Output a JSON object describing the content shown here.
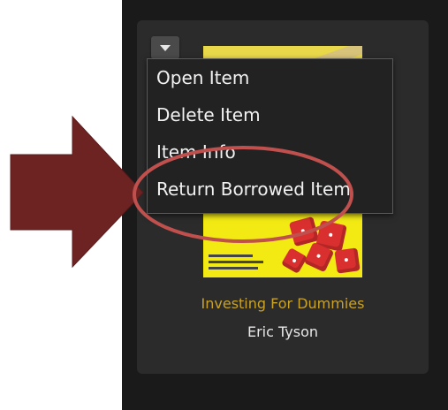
{
  "menu": {
    "items": [
      {
        "label": "Open Item"
      },
      {
        "label": "Delete Item"
      },
      {
        "label": "Item Info"
      },
      {
        "label": "Return Borrowed Item"
      }
    ]
  },
  "book": {
    "title": "Investing For Dummies",
    "author": "Eric Tyson"
  },
  "icons": {
    "dropdown": "chevron-down-icon",
    "arrow": "right-arrow-icon"
  },
  "colors": {
    "background": "#1a1a1a",
    "card": "#2b2b2b",
    "title": "#c9a227",
    "arrow": "#6e2323",
    "highlight": "#c0504d",
    "cover": "#f3ea14"
  }
}
